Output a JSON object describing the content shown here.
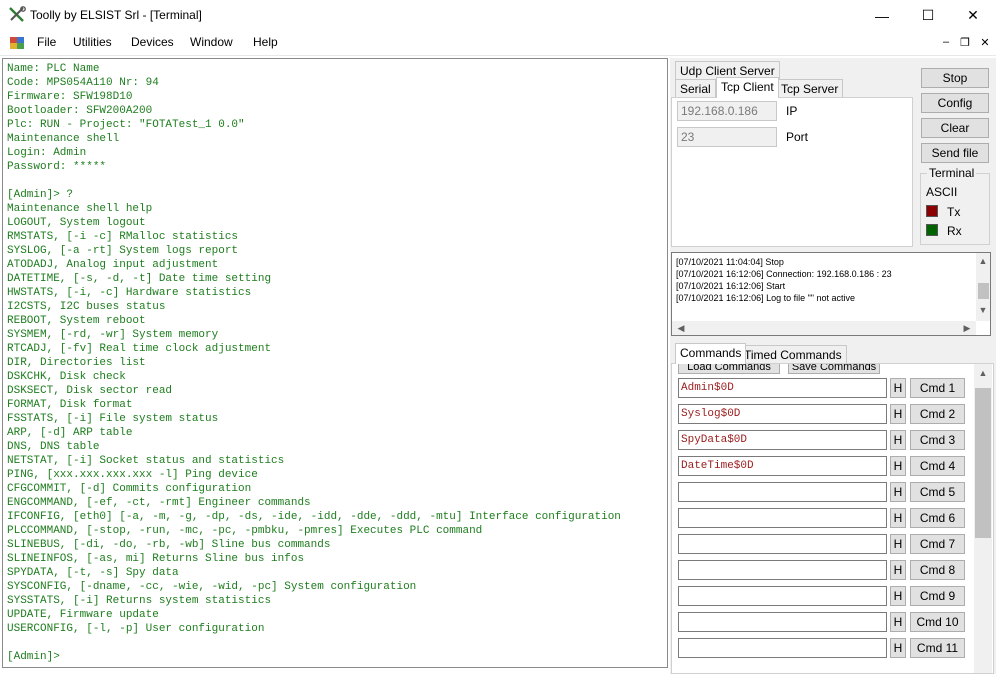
{
  "window": {
    "title": "Toolly by ELSIST Srl - [Terminal]",
    "minimize_glyph": "—",
    "maximize_glyph": "☐",
    "close_glyph": "✕"
  },
  "menu": {
    "items": [
      "File",
      "Utilities",
      "Devices",
      "Window",
      "Help"
    ],
    "mdi_minimize": "‒",
    "mdi_restore": "❐",
    "mdi_close": "✕"
  },
  "terminal": {
    "lines": [
      "Name: PLC Name",
      "Code: MPS054A110 Nr: 94",
      "Firmware: SFW198D10",
      "Bootloader: SFW200A200",
      "Plc: RUN - Project: \"FOTATest_1 0.0\"",
      "Maintenance shell",
      "Login: Admin",
      "Password: *****",
      "",
      "[Admin]> ?",
      "Maintenance shell help",
      "LOGOUT, System logout",
      "RMSTATS, [-i -c] RMalloc statistics",
      "SYSLOG, [-a -rt] System logs report",
      "ATODADJ, Analog input adjustment",
      "DATETIME, [-s, -d, -t] Date time setting",
      "HWSTATS, [-i, -c] Hardware statistics",
      "I2CSTS, I2C buses status",
      "REBOOT, System reboot",
      "SYSMEM, [-rd, -wr] System memory",
      "RTCADJ, [-fv] Real time clock adjustment",
      "DIR, Directories list",
      "DSKCHK, Disk check",
      "DSKSECT, Disk sector read",
      "FORMAT, Disk format",
      "FSSTATS, [-i] File system status",
      "ARP, [-d] ARP table",
      "DNS, DNS table",
      "NETSTAT, [-i] Socket status and statistics",
      "PING, [xxx.xxx.xxx.xxx -l] Ping device",
      "CFGCOMMIT, [-d] Commits configuration",
      "ENGCOMMAND, [-ef, -ct, -rmt] Engineer commands",
      "IFCONFIG, [eth0] [-a, -m, -g, -dp, -ds, -ide, -idd, -dde, -ddd, -mtu] Interface configuration",
      "PLCCOMMAND, [-stop, -run, -mc, -pc, -pmbku, -pmres] Executes PLC command",
      "SLINEBUS, [-di, -do, -rb, -wb] Sline bus commands",
      "SLINEINFOS, [-as, mi] Returns Sline bus infos",
      "SPYDATA, [-t, -s] Spy data",
      "SYSCONFIG, [-dname, -cc, -wie, -wid, -pc] System configuration",
      "SYSSTATS, [-i] Returns system statistics",
      "UPDATE, Firmware update",
      "USERCONFIG, [-l, -p] User configuration",
      "",
      "[Admin]>"
    ]
  },
  "connection": {
    "group_label": "Udp Client Server",
    "tabs": [
      "Serial",
      "Tcp Client",
      "Tcp Server"
    ],
    "active_tab": "Tcp Client",
    "ip_value": "192.168.0.186",
    "ip_label": "IP",
    "port_value": "23",
    "port_label": "Port"
  },
  "side_buttons": {
    "stop": "Stop",
    "config": "Config",
    "clear": "Clear",
    "send_file": "Send file"
  },
  "terminal_group": {
    "label": "Terminal",
    "mode": "ASCII",
    "tx_label": "Tx",
    "rx_label": "Rx",
    "tx_color": "#8b0000",
    "rx_color": "#006400"
  },
  "log": {
    "lines": [
      "[07/10/2021 11:04:04] Stop",
      "[07/10/2021 16:12:06] Connection: 192.168.0.186 : 23",
      "[07/10/2021 16:12:06] Start",
      "[07/10/2021 16:12:06] Log to file \"\" not active"
    ]
  },
  "commands": {
    "tabs": [
      "Commands",
      "Timed Commands"
    ],
    "active_tab": "Commands",
    "load_label": "Load Commands",
    "save_label": "Save Commands",
    "h_label": "H",
    "rows": [
      {
        "value": "Admin$0D",
        "button": "Cmd 1"
      },
      {
        "value": "Syslog$0D",
        "button": "Cmd 2"
      },
      {
        "value": "SpyData$0D",
        "button": "Cmd 3"
      },
      {
        "value": "DateTime$0D",
        "button": "Cmd 4"
      },
      {
        "value": "",
        "button": "Cmd 5"
      },
      {
        "value": "",
        "button": "Cmd 6"
      },
      {
        "value": "",
        "button": "Cmd 7"
      },
      {
        "value": "",
        "button": "Cmd 8"
      },
      {
        "value": "",
        "button": "Cmd 9"
      },
      {
        "value": "",
        "button": "Cmd 10"
      },
      {
        "value": "",
        "button": "Cmd 11"
      }
    ]
  },
  "icons": {
    "app": "tools-icon",
    "menu": "mdi-document-icon"
  }
}
